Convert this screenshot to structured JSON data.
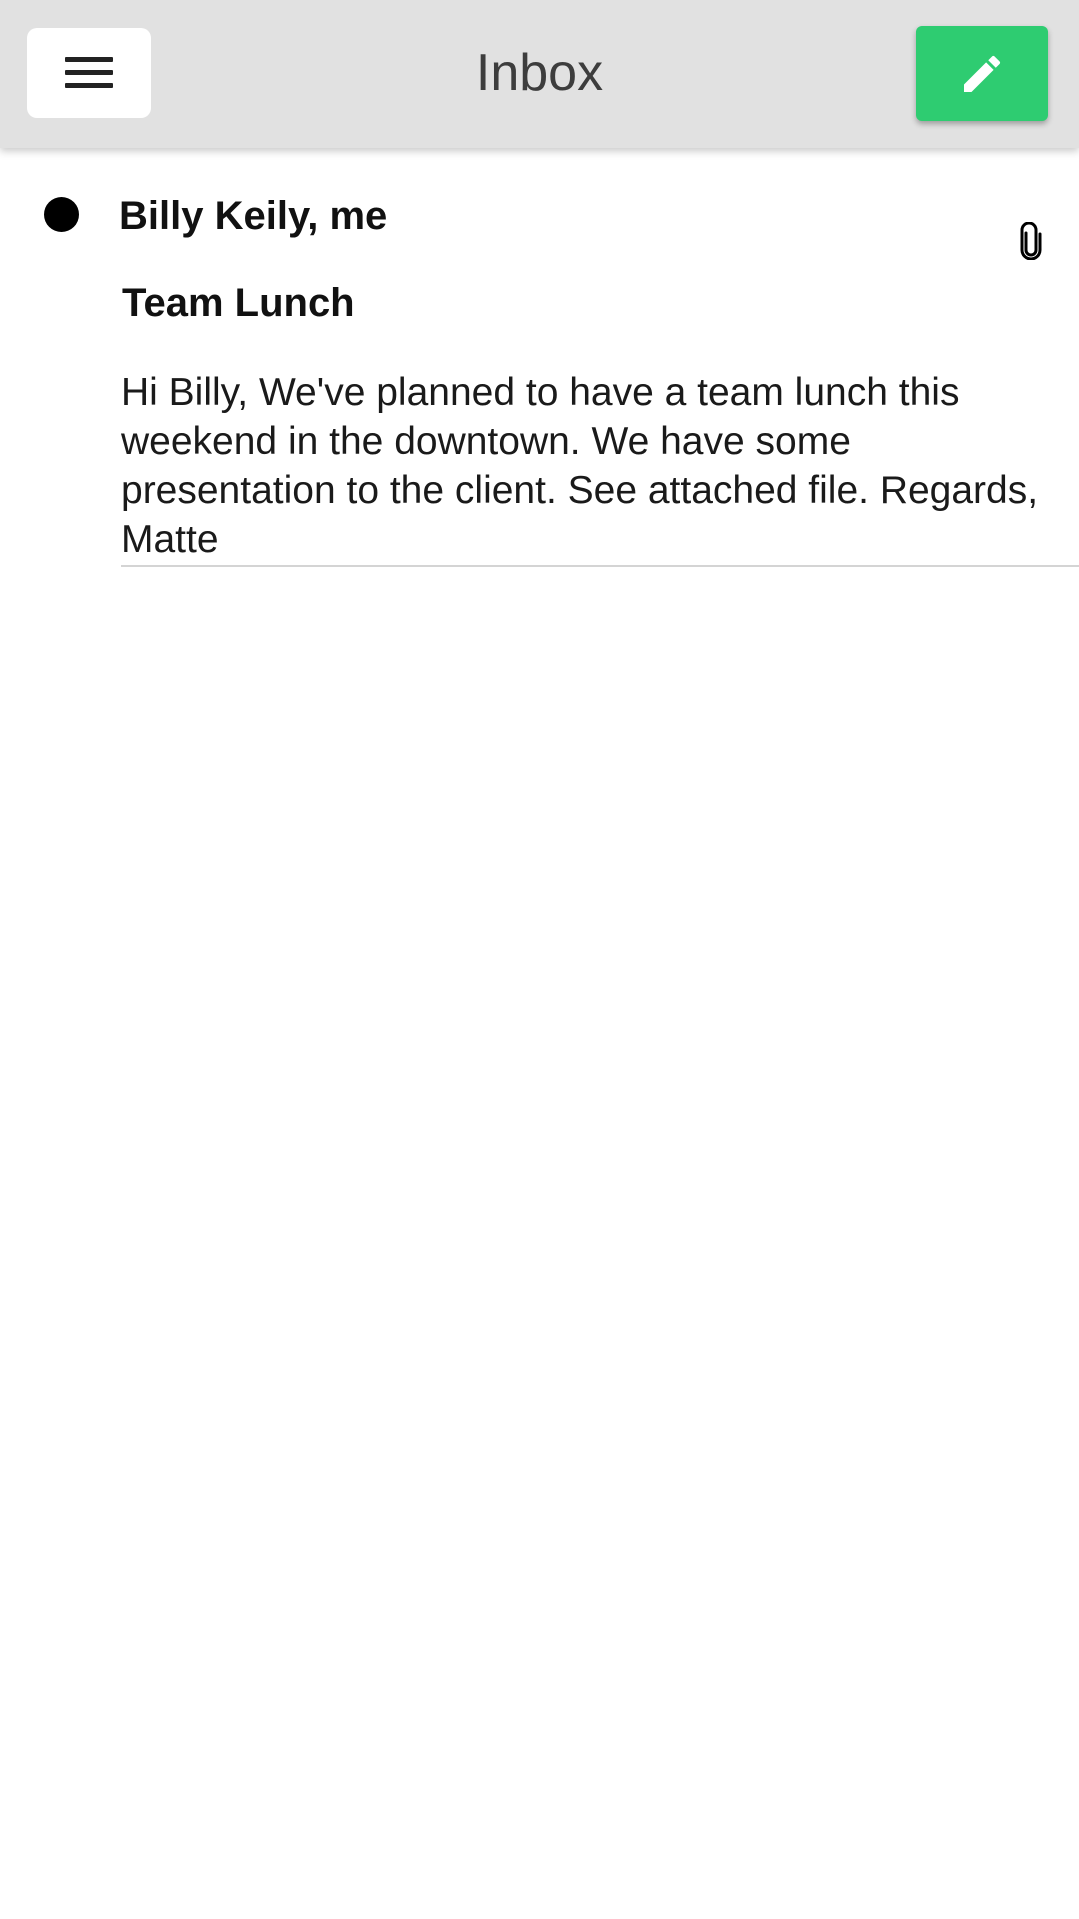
{
  "header": {
    "title": "Inbox",
    "menu_icon": "hamburger-menu-icon",
    "compose_icon": "pencil-icon",
    "background_color": "#e1e1e1",
    "compose_color": "#2ecc71"
  },
  "messages": [
    {
      "unread": true,
      "sender": "Billy Keily, me",
      "subject": "Team Lunch",
      "preview": "Hi Billy, We've planned to have a team lunch this weekend in the downtown. We have some presentation to the client. See attached file. Regards, Matte",
      "has_attachment": true,
      "attachment_icon": "paperclip-icon"
    }
  ]
}
